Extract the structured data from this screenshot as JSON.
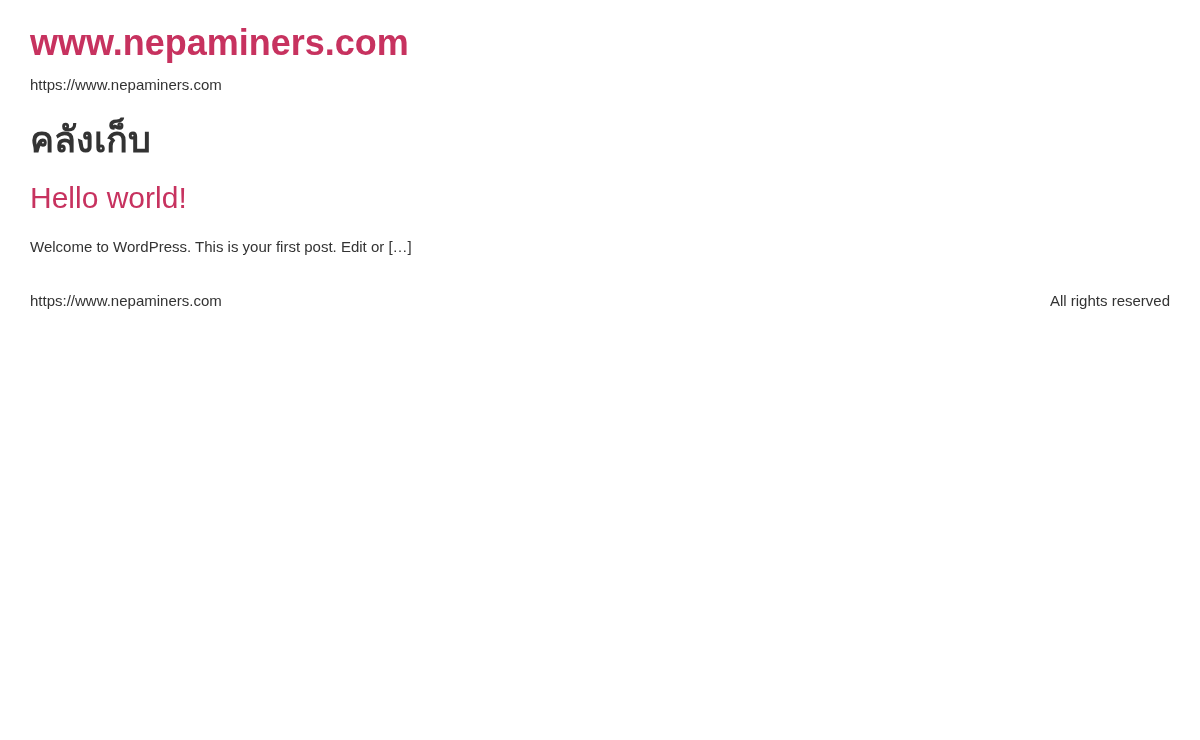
{
  "site": {
    "title": "www.nepaminers.com",
    "tagline": "https://www.nepaminers.com"
  },
  "archive": {
    "heading": "คลังเก็บ"
  },
  "posts": [
    {
      "title": "Hello world!",
      "excerpt": "Welcome to WordPress. This is your first post. Edit or […]"
    }
  ],
  "footer": {
    "left": "https://www.nepaminers.com",
    "right": "All rights reserved"
  }
}
